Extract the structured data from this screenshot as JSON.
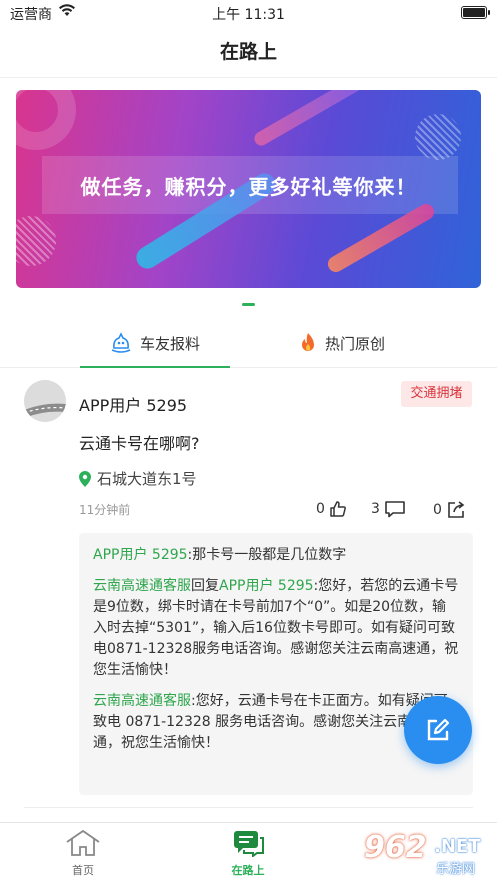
{
  "status_bar": {
    "carrier": "运营商",
    "time": "上午 11:31"
  },
  "nav": {
    "title": "在路上"
  },
  "banner": {
    "text": "做任务，赚积分，更多好礼等你来！"
  },
  "tabs": [
    {
      "label": "车友报料",
      "active": true
    },
    {
      "label": "热门原创",
      "active": false
    }
  ],
  "post": {
    "username": "APP用户 5295",
    "badge": "交通拥堵",
    "content": "云通卡号在哪啊?",
    "location": "石城大道东1号",
    "time_ago": "11分钟前",
    "likes": "0",
    "comments": "3",
    "shares": "0"
  },
  "comments": [
    {
      "author": "APP用户 5295",
      "text": ":那卡号一般都是几位数字"
    },
    {
      "author": "云南高速通客服",
      "mid": "回复",
      "target": "APP用户 5295",
      "text": ":您好，若您的云通卡号是9位数，绑卡时请在卡号前加7个“0”。如是20位数，输入时去掉“5301”，输入后16位数卡号即可。如有疑问可致电0871-12328服务电话咨询。感谢您关注云南高速通，祝您生活愉快！"
    },
    {
      "author": "云南高速通客服",
      "text": ":您好，云通卡号在卡正面方。如有疑问可致电 0871-12328 服务电话咨询。感谢您关注云南高速通，祝您生活愉快！"
    }
  ],
  "tabbar": {
    "home": "首页",
    "road": "在路上"
  },
  "watermark": {
    "num": "962",
    "net": ".NET",
    "sub": "乐游网"
  },
  "colors": {
    "accent": "#2cb15a",
    "badge_text": "#d9363e",
    "badge_bg": "#fde7e7",
    "fab": "#2a8ef0"
  }
}
